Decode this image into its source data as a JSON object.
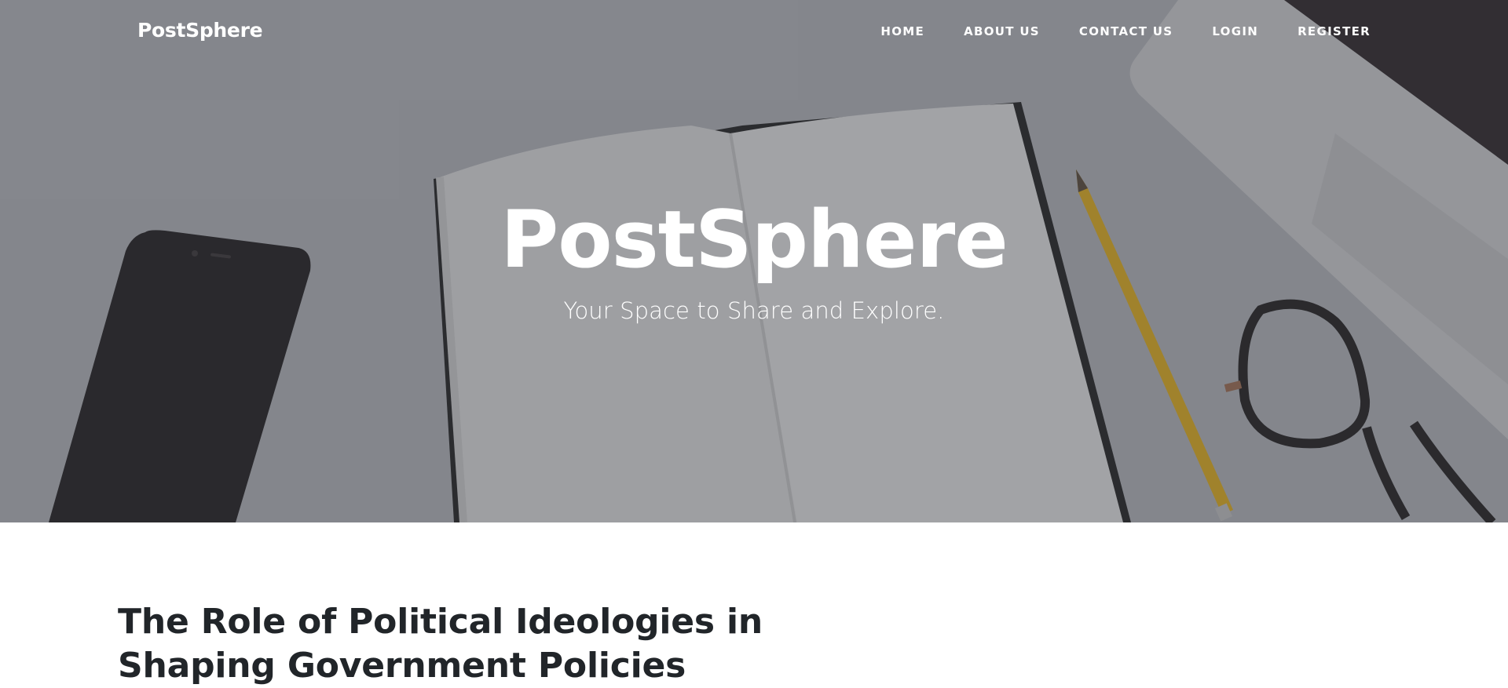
{
  "nav": {
    "brand": "PostSphere",
    "links": [
      {
        "label": "HOME"
      },
      {
        "label": "ABOUT US"
      },
      {
        "label": "CONTACT US"
      },
      {
        "label": "LOGIN"
      },
      {
        "label": "REGISTER"
      }
    ]
  },
  "hero": {
    "title": "PostSphere",
    "subtitle": "Your Space to Share and Explore.",
    "background_icon": "desk-photo-image"
  },
  "article": {
    "title": "The Role of Political Ideologies in Shaping Government Policies"
  },
  "colors": {
    "overlay": "#3c3e46",
    "text_dark": "#212529",
    "text_light": "#ffffff"
  }
}
